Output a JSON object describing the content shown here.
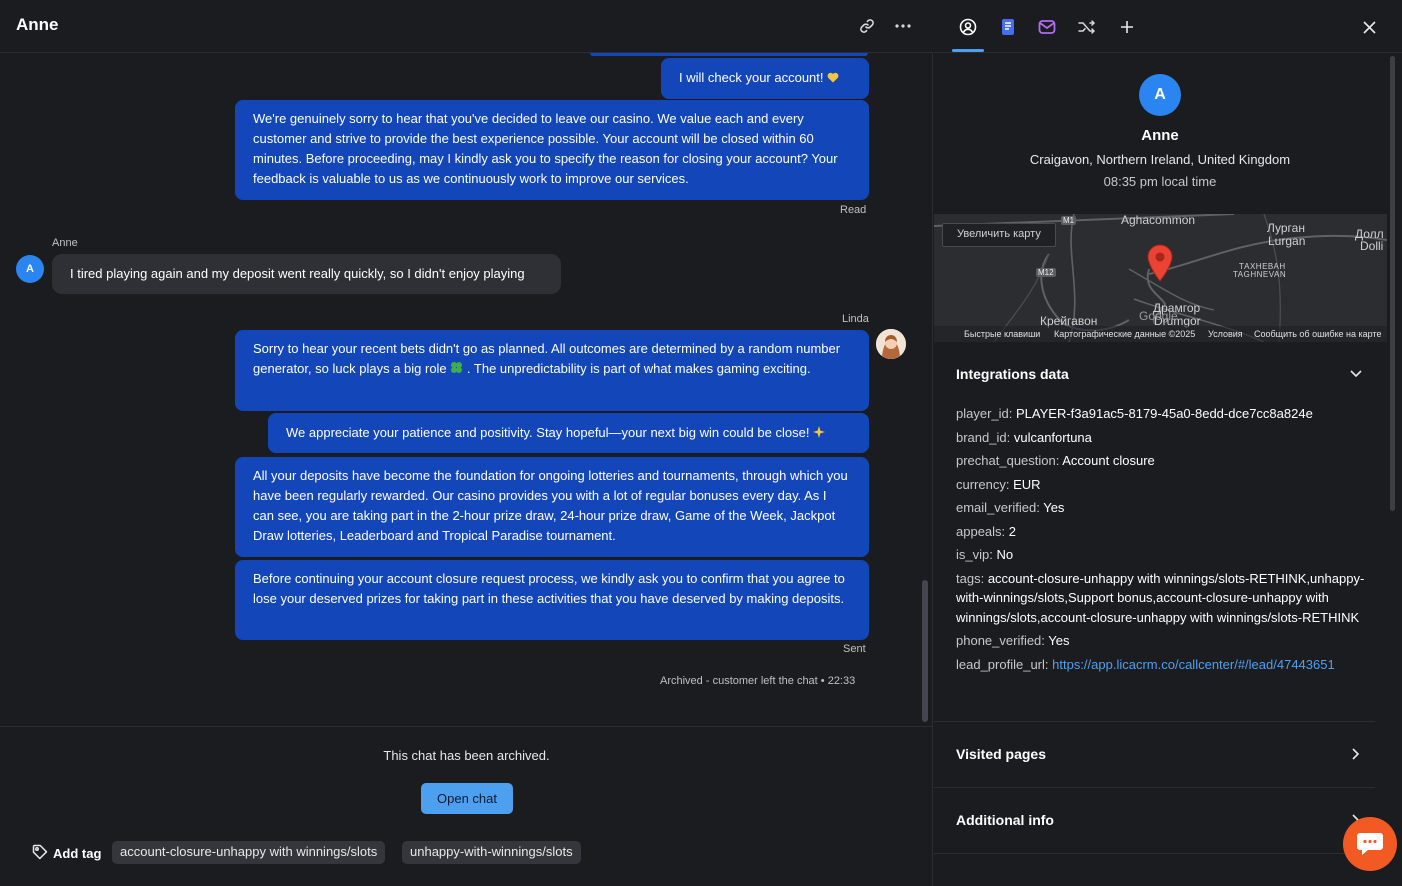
{
  "chat": {
    "title": "Anne",
    "messages": {
      "m1": "I will check your account!",
      "m2": "We're genuinely sorry to hear that you've decided to leave our casino. We value each and every customer and strive to provide the best experience possible. Your account will be closed within 60 minutes. Before proceeding, may I kindly ask you to specify the reason for closing your account? Your feedback is valuable to us as we continuously work to improve our services.",
      "m2_status": "Read",
      "customer_name": "Anne",
      "customer_avatar": "A",
      "m3": "I tired playing again and my deposit went really quickly, so I didn't enjoy playing",
      "agent_name": "Linda",
      "m4_part1": "Sorry to hear your recent bets didn't go as planned. All outcomes are determined by a random number generator, so luck plays a big role",
      "m4_part2": ". The unpredictability is part of what makes gaming exciting.",
      "m5": "We appreciate your patience and positivity. Stay hopeful—your next big win could be close!",
      "m6": "All your deposits have become the foundation for ongoing lotteries and tournaments, through which you have been regularly rewarded. Our casino provides you with a lot of regular bonuses every day. As I can see, you are taking part in the 2-hour prize draw, 24-hour prize draw, Game of the Week, Jackpot Draw lotteries, Leaderboard and Tropical Paradise tournament.",
      "m7": "Before continuing your account closure request process, we kindly ask you to confirm that you agree to lose your deserved prizes for taking part in these activities that you have deserved by making deposits.",
      "m7_status": "Sent",
      "archived_note": "Archived - customer left the chat • 22:33"
    },
    "footer": {
      "archived_text": "This chat has been archived.",
      "open_chat_label": "Open chat",
      "add_tag_label": "Add tag",
      "tags": [
        "account-closure-unhappy with winnings/slots",
        "unhappy-with-winnings/slots"
      ]
    }
  },
  "profile": {
    "avatar_letter": "A",
    "name": "Anne",
    "location": "Craigavon, Northern Ireland, United Kingdom",
    "local_time": "08:35 pm local time"
  },
  "map": {
    "zoom_button": "Увеличить карту",
    "labels": {
      "aghacommon": "Aghacommon",
      "lurgan_ru": "Лурган",
      "lurgan": "Lurgan",
      "doll_ru": "Долл",
      "doll": "Dolli",
      "taghnevan_ru": "ТАХНЕВАН",
      "taghnevan": "TAGHNEVAN",
      "craigavon_ru": "Крейгавон",
      "dramgor_ru": "Драмгор",
      "dramgor": "Drumgor",
      "m1": "M1",
      "m12": "M12",
      "google": "Google"
    },
    "footer": {
      "shortcuts": "Быстрые клавиши",
      "data": "Картографические данные ©2025",
      "terms": "Условия",
      "report": "Сообщить об ошибке на карте"
    }
  },
  "integrations": {
    "title": "Integrations data",
    "fields": {
      "player_id_key": "player_id:",
      "player_id": "PLAYER-f3a91ac5-8179-45a0-8edd-dce7cc8a824e",
      "brand_id_key": "brand_id:",
      "brand_id": "vulcanfortuna",
      "prechat_key": "prechat_question:",
      "prechat": "Account closure",
      "currency_key": "currency:",
      "currency": "EUR",
      "email_key": "email_verified:",
      "email": "Yes",
      "appeals_key": "appeals:",
      "appeals": "2",
      "vip_key": "is_vip:",
      "vip": "No",
      "tags_key": "tags:",
      "tags": "account-closure-unhappy with winnings/slots-RETHINK,unhappy-with-winnings/slots,Support bonus,account-closure-unhappy with winnings/slots,account-closure-unhappy with winnings/slots-RETHINK",
      "phone_key": "phone_verified:",
      "phone": "Yes",
      "lead_key": "lead_profile_url:",
      "lead": "https://app.licacrm.co/callcenter/#/lead/47443651"
    }
  },
  "sections": {
    "visited_pages": "Visited pages",
    "additional_info": "Additional info"
  },
  "colors": {
    "agent_bubble": "#1347b9",
    "customer_bubble": "#2f3036",
    "accent": "#4da0f0",
    "launcher": "#f15a22"
  }
}
